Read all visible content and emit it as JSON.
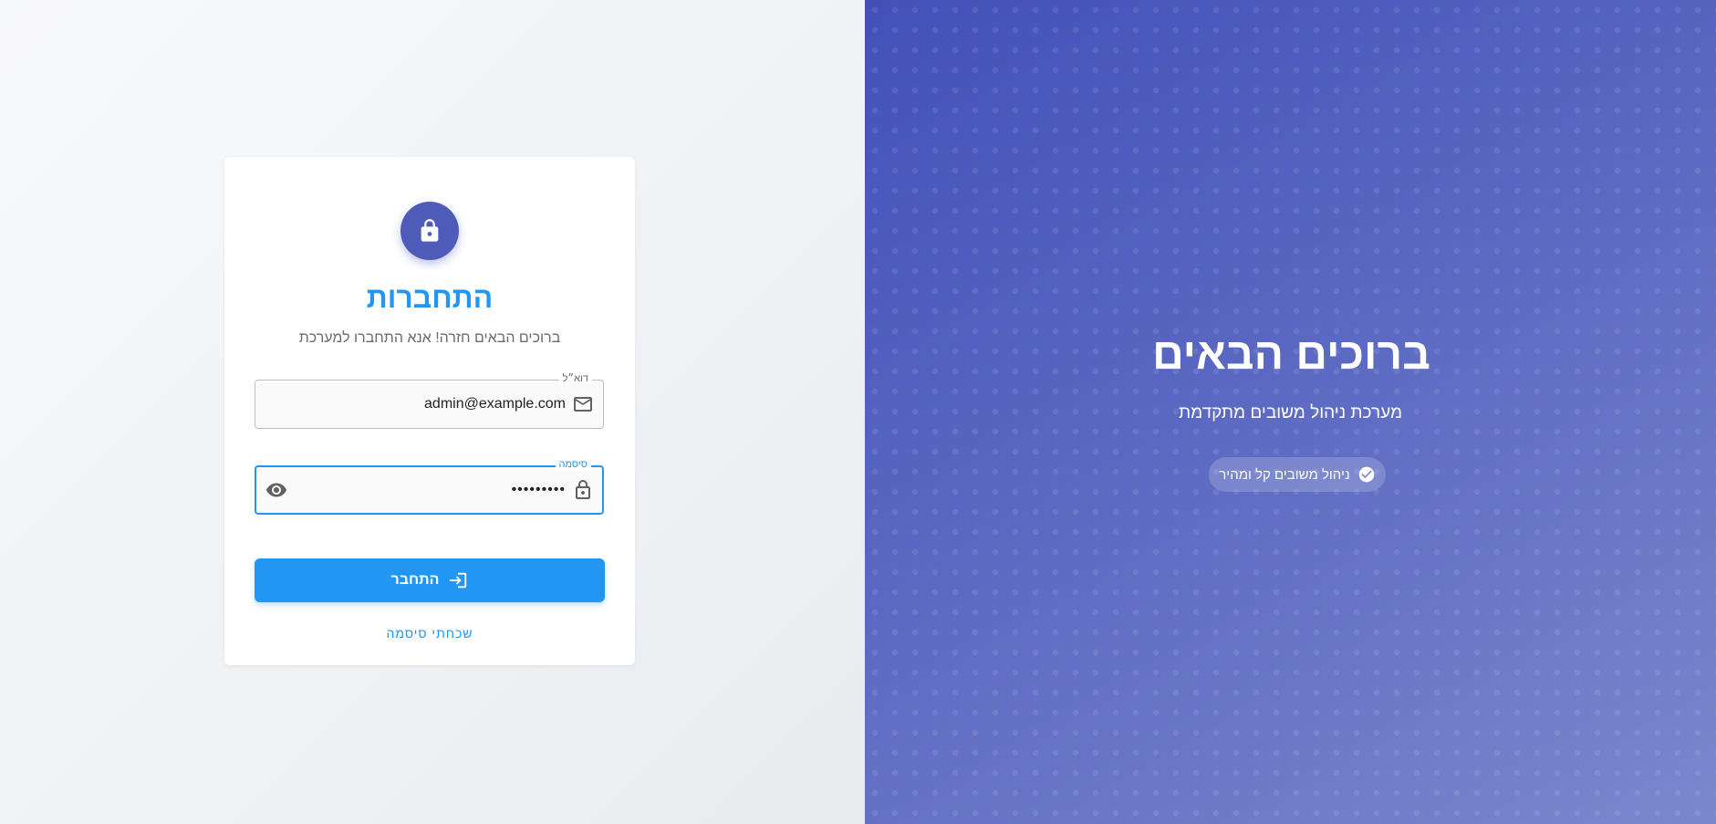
{
  "login": {
    "title": "התחברות",
    "subtitle": "ברוכים הבאים חזרה! אנא התחברו למערכת",
    "email": {
      "label": "דוא״ל",
      "value": "admin@example.com",
      "icon": "mail-icon"
    },
    "password": {
      "label": "סיסמה",
      "value": "•••••••••",
      "icon": "lock-icon",
      "toggle_icon": "eye-icon"
    },
    "submit_label": "התחבר",
    "submit_icon": "login-icon",
    "forgot_label": "שכחתי סיסמה",
    "avatar_icon": "lock-icon"
  },
  "hero": {
    "title": "ברוכים הבאים",
    "subtitle": "מערכת ניהול משובים מתקדמת",
    "chip_label": "ניהול משובים קל ומהיר",
    "chip_icon": "check-circle-icon"
  },
  "colors": {
    "primary": "#2196f3",
    "avatar": "#4f5bb9",
    "hero_gradient_start": "#4350b8",
    "hero_gradient_end": "#7b87cc"
  }
}
